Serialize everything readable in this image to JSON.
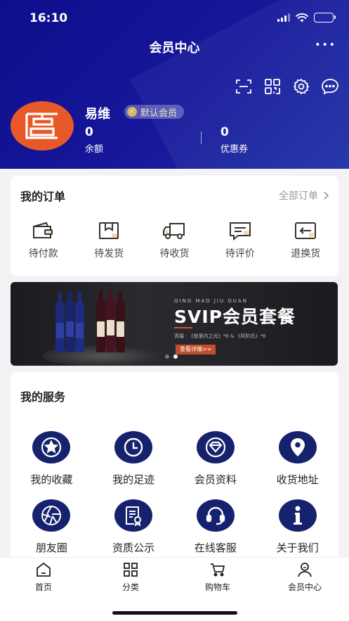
{
  "status_bar": {
    "time": "16:10"
  },
  "header": {
    "title": "会员中心",
    "more_label": "•••"
  },
  "toolbar_icons": [
    "scan-icon",
    "qr-code-icon",
    "gear-icon",
    "chat-icon"
  ],
  "user": {
    "name": "易维",
    "badge": "默认会员",
    "stats": [
      {
        "value": "0",
        "label": "余额"
      },
      {
        "value": "0",
        "label": "优惠券"
      }
    ]
  },
  "orders": {
    "title": "我的订单",
    "all_link": "全部订单",
    "items": [
      {
        "label": "待付款",
        "icon": "wallet-icon"
      },
      {
        "label": "待发货",
        "icon": "package-icon"
      },
      {
        "label": "待收货",
        "icon": "truck-icon"
      },
      {
        "label": "待评价",
        "icon": "comment-icon"
      },
      {
        "label": "退换货",
        "icon": "return-icon"
      }
    ]
  },
  "banner": {
    "subtitle": "QING MAO JIU GUAN",
    "title": "SVIP会员套餐",
    "description": "青猫 · 《帕里内之光》*6 & 《阿豹氏》*6",
    "button": "查看详情>>"
  },
  "services": {
    "title": "我的服务",
    "items": [
      {
        "label": "我的收藏",
        "icon": "star-icon"
      },
      {
        "label": "我的足迹",
        "icon": "clock-icon"
      },
      {
        "label": "会员资料",
        "icon": "diamond-icon"
      },
      {
        "label": "收货地址",
        "icon": "location-icon"
      },
      {
        "label": "朋友圈",
        "icon": "camera-shutter-icon"
      },
      {
        "label": "资质公示",
        "icon": "certificate-icon"
      },
      {
        "label": "在线客服",
        "icon": "headset-icon"
      },
      {
        "label": "关于我们",
        "icon": "info-icon"
      }
    ]
  },
  "tabbar": {
    "items": [
      {
        "label": "首页",
        "icon": "home-icon"
      },
      {
        "label": "分类",
        "icon": "grid-icon"
      },
      {
        "label": "购物车",
        "icon": "cart-icon"
      },
      {
        "label": "会员中心",
        "icon": "user-icon"
      }
    ]
  },
  "colors": {
    "header_bg": "#14158f",
    "service_icon_bg": "#17226e",
    "accent_orange": "#e8592a"
  }
}
